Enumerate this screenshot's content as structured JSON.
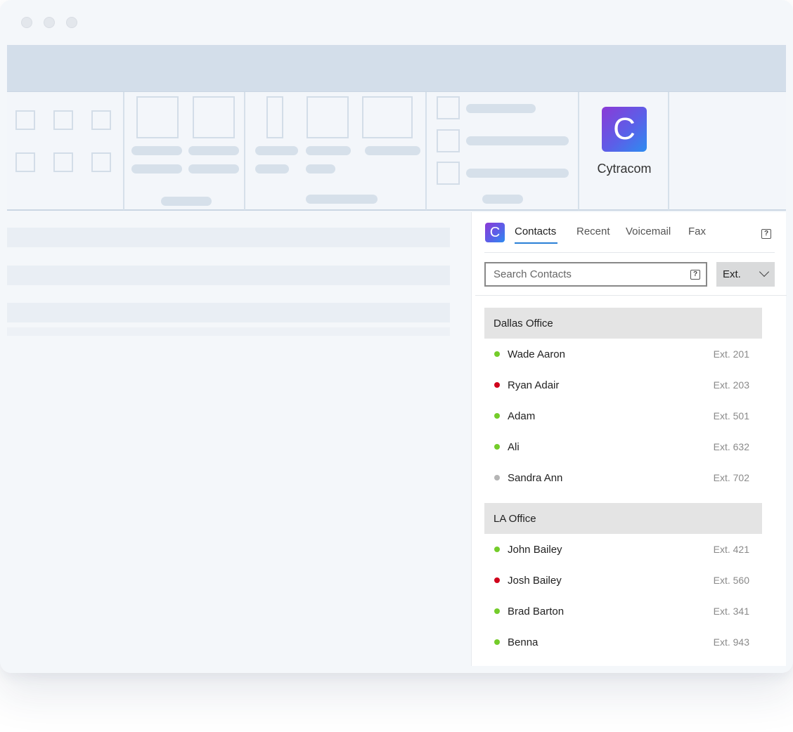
{
  "app": {
    "name": "Cytracom",
    "logo_letter": "C"
  },
  "panel": {
    "tabs": [
      {
        "label": "Contacts",
        "active": true
      },
      {
        "label": "Recent",
        "active": false
      },
      {
        "label": "Voicemail",
        "active": false
      },
      {
        "label": "Fax",
        "active": false
      }
    ],
    "search": {
      "placeholder": "Search Contacts",
      "value": ""
    },
    "filter": {
      "selected": "Ext."
    },
    "groups": [
      {
        "name": "Dallas Office",
        "contacts": [
          {
            "name": "Wade Aaron",
            "ext": "Ext. 201",
            "status": "available"
          },
          {
            "name": "Ryan Adair",
            "ext": "Ext. 203",
            "status": "busy"
          },
          {
            "name": "Adam",
            "ext": "Ext. 501",
            "status": "available"
          },
          {
            "name": "Ali",
            "ext": "Ext. 632",
            "status": "available"
          },
          {
            "name": "Sandra Ann",
            "ext": "Ext. 702",
            "status": "offline"
          }
        ]
      },
      {
        "name": "LA Office",
        "contacts": [
          {
            "name": "John Bailey",
            "ext": "Ext. 421",
            "status": "available"
          },
          {
            "name": "Josh Bailey",
            "ext": "Ext. 560",
            "status": "busy"
          },
          {
            "name": "Brad Barton",
            "ext": "Ext. 341",
            "status": "available"
          },
          {
            "name": "Benna",
            "ext": "Ext. 943",
            "status": "available"
          }
        ]
      }
    ]
  },
  "colors": {
    "available": "#74cc2a",
    "busy": "#d0021b",
    "offline": "#b5b5b5",
    "accent": "#2a7fd6"
  },
  "icons": {
    "help": "question-box-icon",
    "dropdown": "chevron-down-icon"
  }
}
